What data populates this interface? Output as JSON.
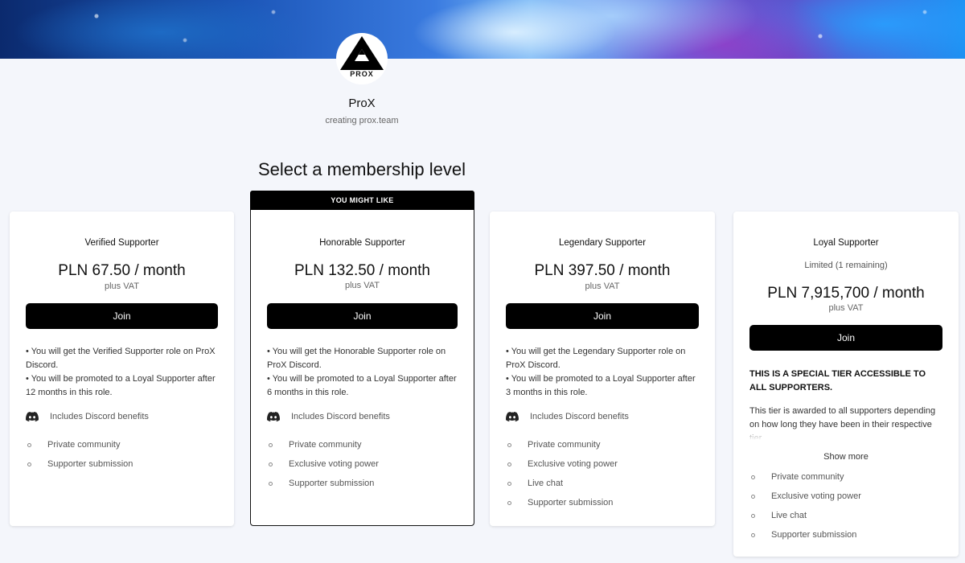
{
  "creator": {
    "logo_text": "PROX",
    "name": "ProX",
    "tagline": "creating prox.team"
  },
  "section_title": "Select a membership level",
  "tiers": [
    {
      "name": "Verified Supporter",
      "price": "PLN 67.50 / month",
      "vat": "plus VAT",
      "join_label": "Join",
      "desc": [
        "• You will get the Verified Supporter role on ProX Discord.",
        "• You will be promoted to a Loyal Supporter after 12 months in this role."
      ],
      "discord": "Includes Discord benefits",
      "benefits": [
        "Private community",
        "Supporter submission"
      ]
    },
    {
      "ribbon": "YOU MIGHT LIKE",
      "name": "Honorable Supporter",
      "price": "PLN 132.50 / month",
      "vat": "plus VAT",
      "join_label": "Join",
      "desc": [
        "• You will get the Honorable Supporter role on ProX Discord.",
        "• You will be promoted to a Loyal Supporter after 6 months in this role."
      ],
      "discord": "Includes Discord benefits",
      "benefits": [
        "Private community",
        "Exclusive voting power",
        "Supporter submission"
      ]
    },
    {
      "name": "Legendary Supporter",
      "price": "PLN 397.50 / month",
      "vat": "plus VAT",
      "join_label": "Join",
      "desc": [
        "• You will get the Legendary Supporter role on ProX Discord.",
        "• You will be promoted to a Loyal Supporter after 3 months in this role."
      ],
      "discord": "Includes Discord benefits",
      "benefits": [
        "Private community",
        "Exclusive voting power",
        "Live chat",
        "Supporter submission"
      ]
    },
    {
      "name": "Loyal Supporter",
      "limited": "Limited (1 remaining)",
      "price": "PLN 7,915,700 / month",
      "vat": "plus VAT",
      "join_label": "Join",
      "special": "THIS IS A SPECIAL TIER ACCESSIBLE TO ALL SUPPORTERS.",
      "desc_text": "This tier is awarded to all supporters depending on how long they have been in their respective tier.",
      "show_more": "Show more",
      "benefits": [
        "Private community",
        "Exclusive voting power",
        "Live chat",
        "Supporter submission"
      ]
    }
  ]
}
